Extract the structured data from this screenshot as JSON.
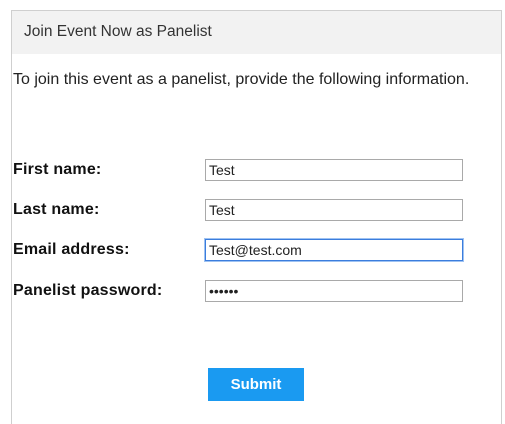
{
  "dialog": {
    "title": "Join Event Now as Panelist",
    "intro": "To join this event as a panelist, provide the following information."
  },
  "form": {
    "first_name": {
      "label": "First name:",
      "value": "Test"
    },
    "last_name": {
      "label": "Last name:",
      "value": "Test"
    },
    "email": {
      "label": "Email address:",
      "value": "Test@test.com"
    },
    "password": {
      "label": "Panelist password:",
      "value": "••••••"
    }
  },
  "actions": {
    "submit_label": "Submit"
  },
  "colors": {
    "accent": "#1a9af1",
    "header_bg": "#f2f2f2",
    "focus_border": "#3b7ddd"
  }
}
